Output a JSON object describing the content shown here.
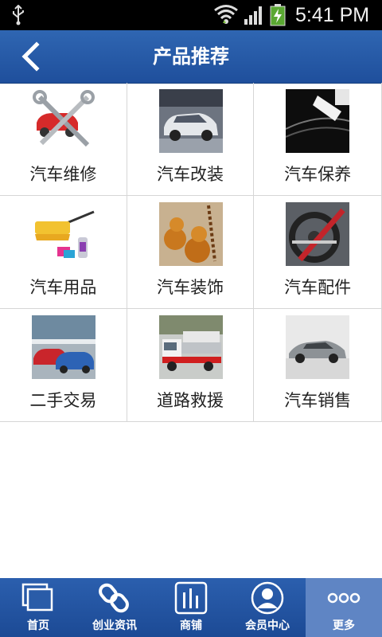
{
  "status_bar": {
    "time": "5:41 PM"
  },
  "header": {
    "title": "产品推荐",
    "back_icon": "back-arrow-icon"
  },
  "categories": [
    {
      "label": "汽车维修",
      "image": "car-repair-tools"
    },
    {
      "label": "汽车改装",
      "image": "modified-car"
    },
    {
      "label": "汽车保养",
      "image": "car-polishing"
    },
    {
      "label": "汽车用品",
      "image": "car-cleaning-supplies"
    },
    {
      "label": "汽车装饰",
      "image": "gourd-ornament"
    },
    {
      "label": "汽车配件",
      "image": "steering-wheel-lock"
    },
    {
      "label": "二手交易",
      "image": "used-cars-lot"
    },
    {
      "label": "道路救援",
      "image": "tow-truck"
    },
    {
      "label": "汽车销售",
      "image": "sports-car"
    }
  ],
  "tabs": [
    {
      "label": "首页",
      "icon": "home-icon"
    },
    {
      "label": "创业资讯",
      "icon": "link-icon"
    },
    {
      "label": "商铺",
      "icon": "store-icon"
    },
    {
      "label": "会员中心",
      "icon": "member-icon"
    },
    {
      "label": "更多",
      "icon": "more-icon"
    }
  ],
  "colors": {
    "header_bg": "#2a5ca8",
    "tabbar_bg": "#1f4f9c",
    "active_tab_bg": "#5f85c4"
  }
}
